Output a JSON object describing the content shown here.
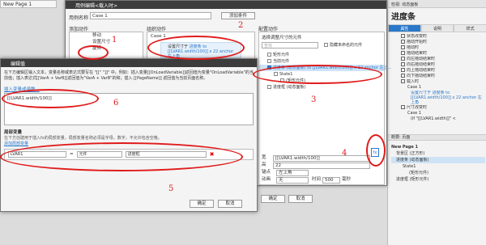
{
  "top_tab": "New Page 1",
  "case_dialog": {
    "title": "用例编辑<载入时>",
    "case_name_label": "用例名称",
    "case_name_value": "Case 1",
    "add_condition": "添加条件",
    "col1_head": "添加动作",
    "col1_items": [
      "移动",
      "设置尺寸",
      "旋转"
    ],
    "col2_head": "组织动作",
    "col2_case": "Case 1",
    "col2_action_title": "设置尺寸于",
    "col2_action_detail": "进度条 to [[LVAR1.width/100]] x 22 anchor 左上角",
    "col3_head": "配置动作",
    "col3_sub": "选择调整尺寸的元件",
    "col3_search_placeholder": "查找",
    "col3_hide": "隐藏未命名的元件",
    "col3_items": [
      {
        "label": "矩形元件",
        "checked": false,
        "selected": false
      },
      {
        "label": "当前元件",
        "checked": false,
        "selected": false
      },
      {
        "label": "进度条 (动态面板) to [[LVAR1.width/100]] x 22 anchor 左上...",
        "checked": true,
        "selected": true
      },
      {
        "label": "State1",
        "checked": false,
        "selected": false
      },
      {
        "label": "(矩形元件)",
        "checked": false,
        "selected": false
      },
      {
        "label": "进度框 (动态面板)",
        "checked": false,
        "selected": false
      }
    ],
    "prop_w_label": "宽",
    "prop_w_value": "[[LVAR1.width/100]]",
    "prop_h_label": "高",
    "prop_h_value": "22",
    "prop_anchor_label": "锚点",
    "prop_anchor_value": "左上角",
    "prop_anim_label": "动画",
    "prop_anim_value": "无",
    "prop_time_label": "时间",
    "prop_time_value": "500",
    "prop_ms": "毫秒",
    "fx": "fx",
    "ok": "确定",
    "cancel": "取消"
  },
  "edit_value_dialog": {
    "title": "编辑值",
    "description": "在下方编辑区输入文本，变量名称或表达式要写在 \"[[\" \"]]\" 中。例如：插入变量[[OnLoadVariable]]返回值为变量\"OnLoadVariable\"的当前值；插入表达式[[VarA + VarB]]返回值为\"VarA + VarB\"的和；插入 [[PageName]] 返回值为当前页面名称。",
    "insert_link": "插入变量或函数...",
    "expression": "[[LVAR1.width/100]]",
    "local_vars_head": "局部变量",
    "local_vars_desc": "在下方创建用于插入fx的局部变量，局部变量名称必须是字母，数字，不允许包含空格。",
    "add_local": "添加局部变量",
    "var_name": "LVAR1",
    "var_eq": "=",
    "var_type": "元件",
    "var_target": "进度框",
    "ok": "确定",
    "cancel": "取消"
  },
  "right_panel": {
    "topbar": "检视: 动态面板",
    "title": "进度条",
    "tabs": [
      "属性",
      "说明",
      "样式"
    ],
    "events": [
      "状态改变时",
      "拖动开始时",
      "拖动时",
      "拖动结束时",
      "向左拖动结束时",
      "向右拖动结束时",
      "向上拖动结束时",
      "向下拖动结束时",
      "载入时"
    ],
    "case1": "Case 1",
    "case1_action": "设置尺寸于 进度条 to [[LVAR1.width/100]] x 22 anchor 左上角",
    "resize_event": "尺寸改变时",
    "case1b": "Case 1",
    "case1b_cond": "(If \"[[LVAR1.width]]\" <",
    "pages_bar": "概要: 页面",
    "page_name": "New Page 1",
    "page_items": [
      "背景区 (正方形)",
      "进度条 (动态面板)",
      "State1",
      "(矩形元件)",
      "进度框 (矩形元件)"
    ]
  },
  "annotations": [
    "1",
    "2",
    "3",
    "4",
    "5",
    "6"
  ]
}
